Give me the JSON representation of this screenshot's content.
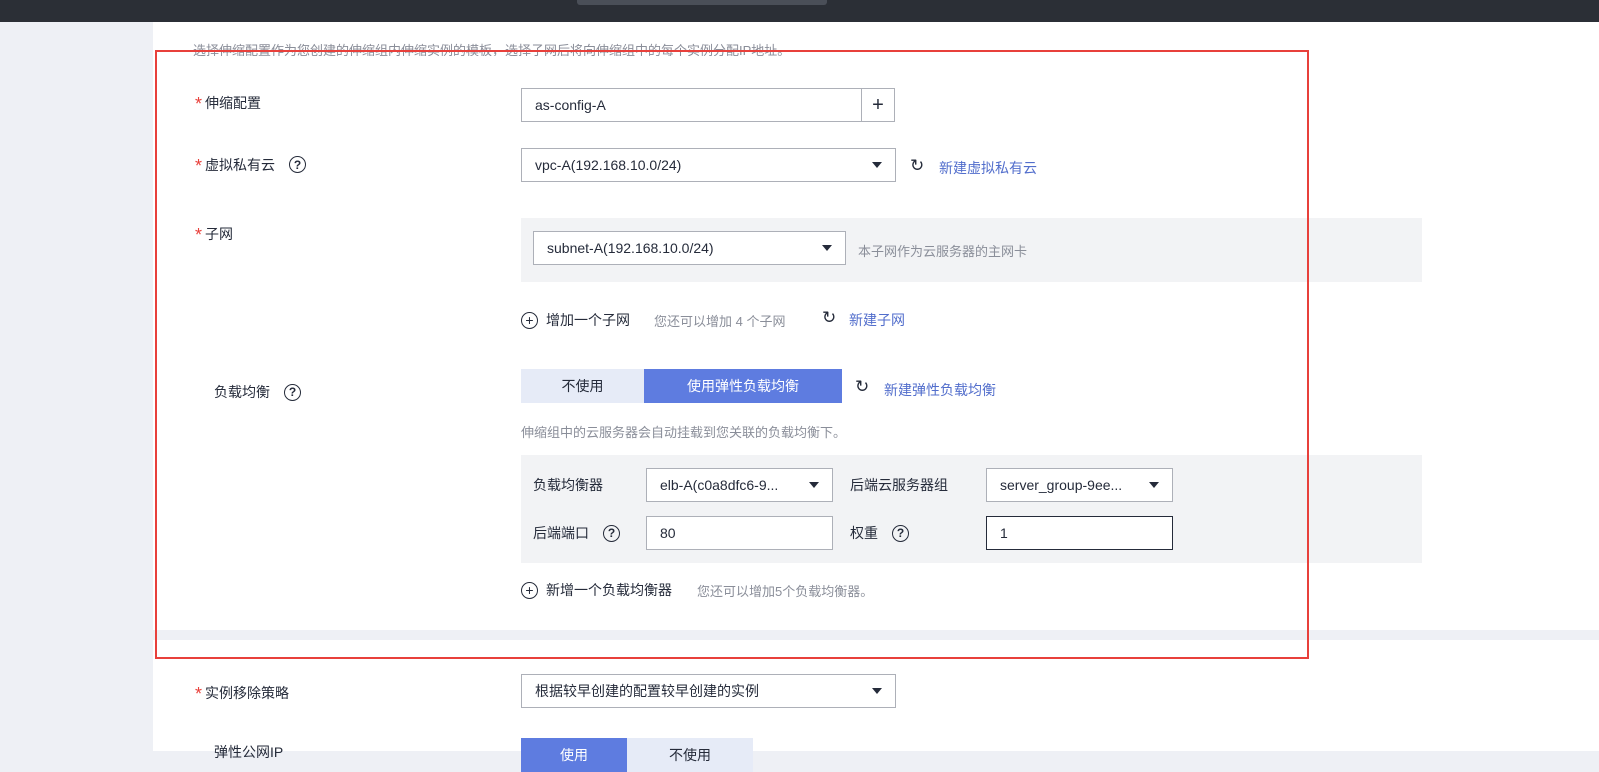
{
  "description": "选择伸缩配置作为您创建的伸缩组内伸缩实例的模板，选择子网后将向伸缩组中的每个实例分配IP地址。",
  "required_mark": "*",
  "help_glyph": "?",
  "refresh_glyph": "↻",
  "add_glyph": "+",
  "config": {
    "label": "伸缩配置",
    "value": "as-config-A"
  },
  "vpc": {
    "label": "虚拟私有云",
    "value": "vpc-A(192.168.10.0/24)",
    "link": "新建虚拟私有云"
  },
  "subnet": {
    "label": "子网",
    "value": "subnet-A(192.168.10.0/24)",
    "hint": "本子网作为云服务器的主网卡",
    "add_label": "增加一个子网",
    "add_hint": "您还可以增加 4 个子网",
    "link": "新建子网"
  },
  "lb": {
    "label": "负载均衡",
    "options": [
      "不使用",
      "使用弹性负载均衡"
    ],
    "selected": "使用弹性负载均衡",
    "link": "新建弹性负载均衡",
    "hint": "伸缩组中的云服务器会自动挂载到您关联的负载均衡下。",
    "balancer_label": "负载均衡器",
    "balancer_value": "elb-A(c0a8dfc6-9...",
    "backend_group_label": "后端云服务器组",
    "backend_group_value": "server_group-9ee...",
    "port_label": "后端端口",
    "port_value": "80",
    "weight_label": "权重",
    "weight_value": "1",
    "add_label": "新增一个负载均衡器",
    "add_hint": "您还可以增加5个负载均衡器。"
  },
  "removal": {
    "label": "实例移除策略",
    "value": "根据较早创建的配置较早创建的实例"
  },
  "eip": {
    "label": "弹性公网IP",
    "options": [
      "使用",
      "不使用"
    ]
  },
  "colors": {
    "accent": "#5e7ce0",
    "link": "#526ecc",
    "required": "#e8403b",
    "highlight_border": "#e8403b"
  }
}
